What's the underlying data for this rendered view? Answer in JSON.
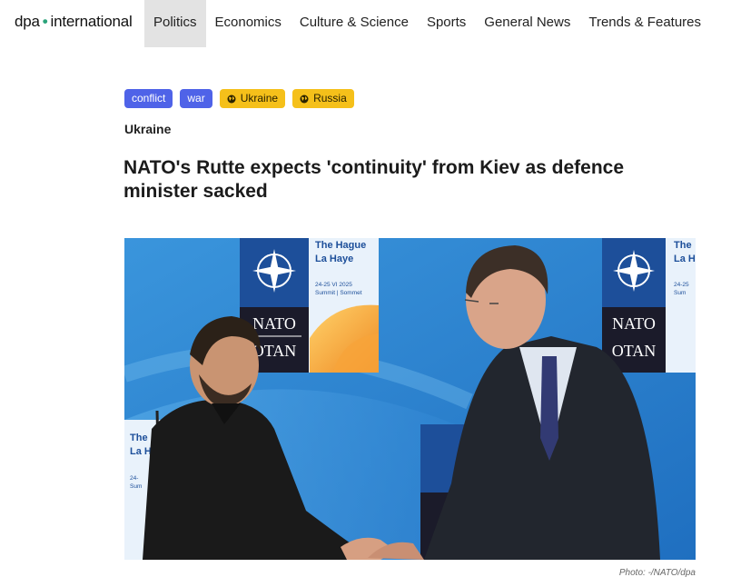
{
  "header": {
    "logo_left": "dpa",
    "logo_sep": "•",
    "logo_right": "international",
    "nav": [
      {
        "label": "Politics",
        "active": true
      },
      {
        "label": "Economics",
        "active": false
      },
      {
        "label": "Culture & Science",
        "active": false
      },
      {
        "label": "Sports",
        "active": false
      },
      {
        "label": "General News",
        "active": false
      },
      {
        "label": "Trends & Features",
        "active": false
      }
    ]
  },
  "tags": [
    {
      "label": "conflict",
      "color": "#4f63e8",
      "icon": ""
    },
    {
      "label": "war",
      "color": "#4f63e8",
      "icon": ""
    },
    {
      "label": "Ukraine",
      "color": "#f5c01a",
      "icon": "globe-icon"
    },
    {
      "label": "Russia",
      "color": "#f5c01a",
      "icon": "globe-icon"
    }
  ],
  "article": {
    "kicker": "Ukraine",
    "headline": "NATO's Rutte expects 'continuity' from Kiev as defence minister sacked",
    "photo_credit": "Photo: -/NATO/dpa"
  },
  "photo": {
    "backdrop_upper": {
      "line1": "The Hague",
      "line2": "La Haye",
      "dates": "24-25 VI 2025",
      "summit": "Summit | Sommet"
    },
    "backdrop_lower": {
      "line1": "The",
      "line2": "La H",
      "dates": "24-",
      "summit": "Sum"
    },
    "backdrop_right": {
      "line1": "The",
      "line2": "La H",
      "dates": "24-25",
      "summit": "Sum"
    },
    "nato_en": "NATO",
    "nato_fr": "OTAN"
  }
}
